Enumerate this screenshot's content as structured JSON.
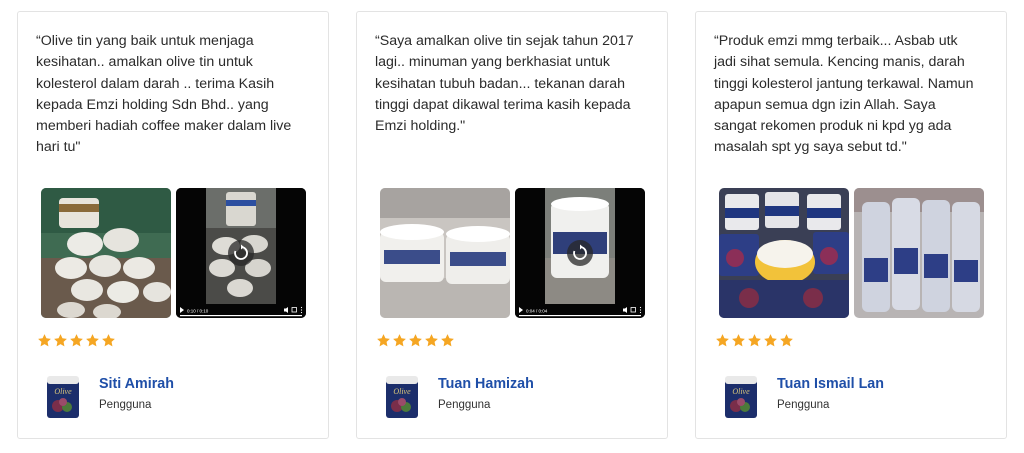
{
  "testimonials": [
    {
      "quote": "“Olive tin yang baik untuk menjaga kesihatan.. amalkan olive tin untuk kolesterol dalam darah .. terima Kasih kepada Emzi holding Sdn Bhd.. yang memberi hadiah coffee maker dalam live hari tu\"",
      "rating": 5,
      "name": "Siti Amirah",
      "role": "Pengguna",
      "video_time": "0:10 / 0:10"
    },
    {
      "quote": "“Saya amalkan olive tin sejak tahun 2017 lagi.. minuman yang berkhasiat untuk kesihatan tubuh badan... tekanan darah tinggi dapat dikawal terima kasih kepada Emzi holding.\"",
      "rating": 5,
      "name": "Tuan Hamizah",
      "role": "Pengguna",
      "video_time": "0:04 / 0:04"
    },
    {
      "quote": "“Produk emzi mmg terbaik... Asbab utk jadi sihat semula. Kencing manis, darah tinggi kolesterol jantung terkawal. Namun apapun semua dgn izin Allah. Saya sangat rekomen produk ni kpd yg ada masalah spt yg saya sebut td.\"",
      "rating": 5,
      "name": "Tuan Ismail Lan",
      "role": "Pengguna",
      "video_time": ""
    }
  ],
  "icons": {
    "star": "star-icon",
    "replay": "replay-icon",
    "play": "play-icon",
    "volume": "volume-icon",
    "fullscreen": "fullscreen-icon",
    "more": "more-options-icon"
  },
  "colors": {
    "star": "#f5a623",
    "name": "#1f4fa8",
    "card_border": "#e3e3e3",
    "text": "#2b2b2b"
  }
}
